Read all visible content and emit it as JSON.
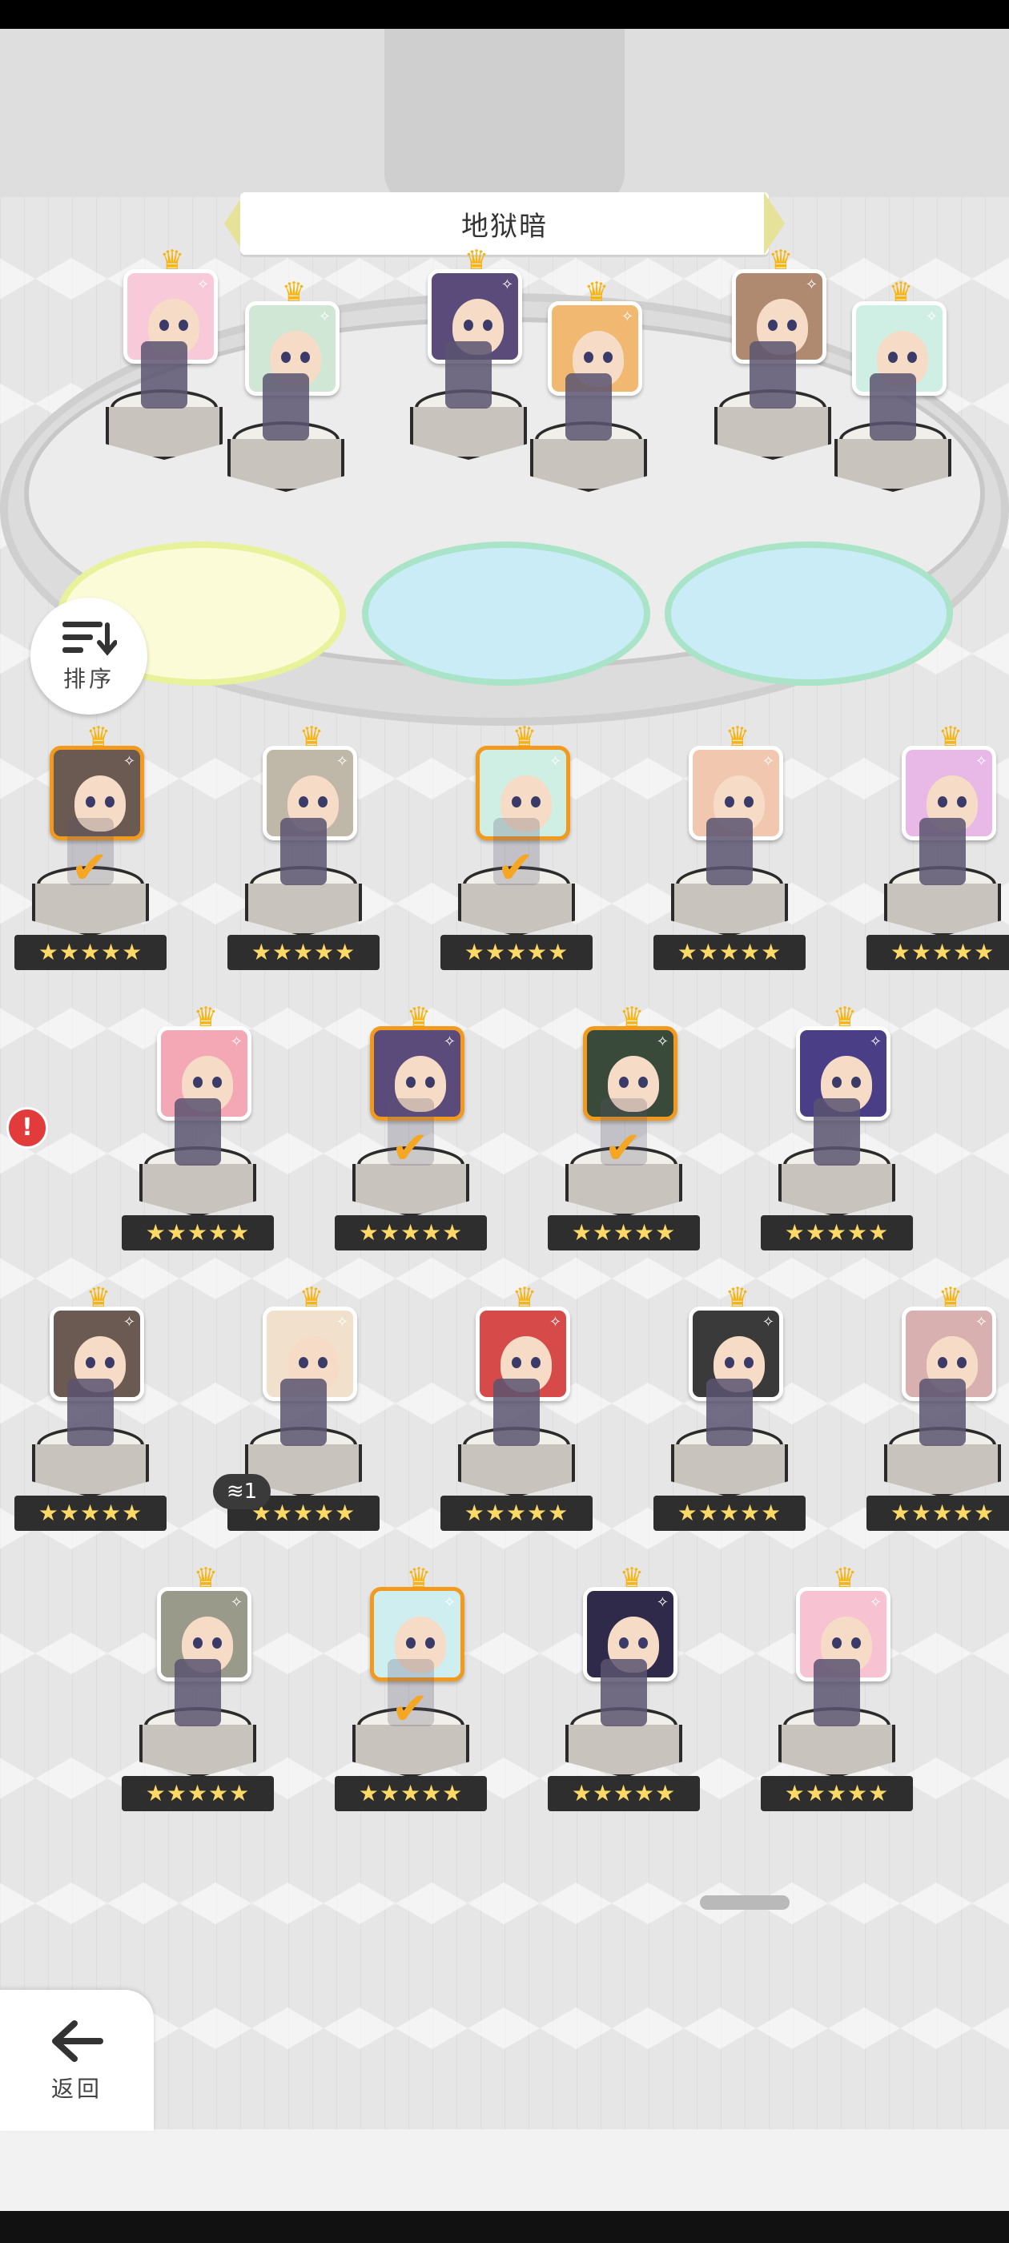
{
  "stage": {
    "title": "地狱暗"
  },
  "sort_button": {
    "label": "排序"
  },
  "back_button": {
    "label": "返回"
  },
  "stack_badge": {
    "count": "1"
  },
  "alert_badge": {
    "symbol": "!"
  },
  "colors": {
    "selected_border": "#f29a1e",
    "crown": "#f7b514",
    "check": "#f5a623",
    "star": "#ffd966"
  },
  "team_slots": [
    {
      "name": "team-member-1"
    },
    {
      "name": "team-member-2"
    },
    {
      "name": "team-member-3"
    },
    {
      "name": "team-member-4"
    },
    {
      "name": "team-member-5"
    },
    {
      "name": "team-member-6"
    }
  ],
  "roster": [
    {
      "row": 1,
      "col": 1,
      "selected": true,
      "rating": "★★★★★"
    },
    {
      "row": 1,
      "col": 2,
      "selected": false,
      "rating": "★★★★★"
    },
    {
      "row": 1,
      "col": 3,
      "selected": true,
      "rating": "★★★★★"
    },
    {
      "row": 1,
      "col": 4,
      "selected": false,
      "rating": "★★★★★"
    },
    {
      "row": 1,
      "col": 5,
      "selected": false,
      "rating": "★★★★★"
    },
    {
      "row": 2,
      "col": 1,
      "selected": false,
      "rating": "★★★★★"
    },
    {
      "row": 2,
      "col": 2,
      "selected": true,
      "rating": "★★★★★"
    },
    {
      "row": 2,
      "col": 3,
      "selected": true,
      "rating": "★★★★★"
    },
    {
      "row": 2,
      "col": 4,
      "selected": false,
      "rating": "★★★★★"
    },
    {
      "row": 3,
      "col": 1,
      "selected": false,
      "rating": "★★★★★"
    },
    {
      "row": 3,
      "col": 2,
      "selected": false,
      "rating": "★★★★★"
    },
    {
      "row": 3,
      "col": 3,
      "selected": false,
      "rating": "★★★★★"
    },
    {
      "row": 3,
      "col": 4,
      "selected": false,
      "rating": "★★★★★"
    },
    {
      "row": 3,
      "col": 5,
      "selected": false,
      "rating": "★★★★★"
    },
    {
      "row": 4,
      "col": 1,
      "selected": false,
      "rating": "★★★★★"
    },
    {
      "row": 4,
      "col": 2,
      "selected": true,
      "rating": "★★★★★"
    },
    {
      "row": 4,
      "col": 3,
      "selected": false,
      "rating": "★★★★★"
    },
    {
      "row": 4,
      "col": 4,
      "selected": false,
      "rating": "★★★★★"
    }
  ]
}
